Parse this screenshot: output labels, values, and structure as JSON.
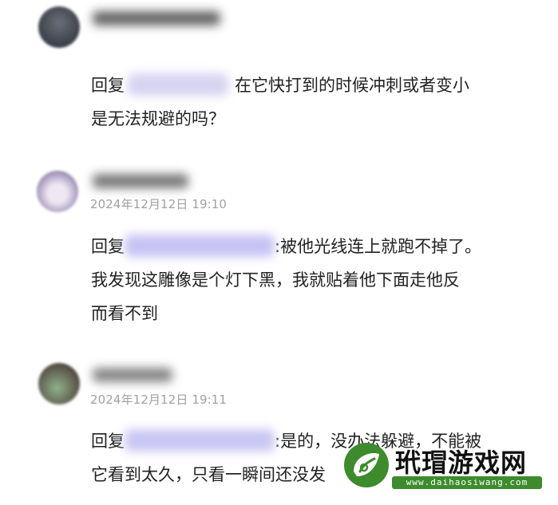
{
  "comments": [
    {
      "reply_prefix": "回复",
      "lines": [
        "在它快打到的时候冲刺或者变小",
        "是无法规避的吗？"
      ]
    },
    {
      "timestamp": "2024年12月12日 19:10",
      "reply_prefix": "回复",
      "lines": [
        ":被他光线连上就跑不掉了。",
        "我发现这雕像是个灯下黑，我就贴着他下面走他反",
        "而看不到"
      ]
    },
    {
      "timestamp": "2024年12月12日 19:11",
      "reply_prefix": "回复",
      "lines": [
        ":是的，没办法躲避，不能被",
        "它看到太久，只看一瞬间还没发"
      ]
    }
  ],
  "watermark": {
    "title": "玳瑁游戏网",
    "url": "www.daihaosiwang.com"
  },
  "colors": {
    "text": "#222222",
    "timestamp": "#a0a0a0",
    "mention_blur": "#c9c6f2",
    "watermark_green": "#3d8b2d"
  }
}
